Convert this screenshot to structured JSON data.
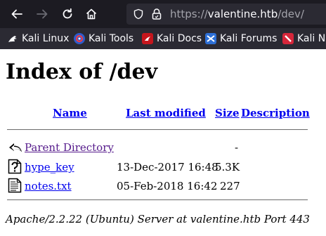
{
  "browser": {
    "url_scheme": "https://",
    "url_host": "valentine.htb",
    "url_path": "/dev/",
    "icons": [
      "back-arrow-icon",
      "forward-arrow-icon",
      "reload-icon",
      "home-icon",
      "shield-icon",
      "lock-icon"
    ],
    "bookmarks": [
      {
        "label": "Kali Linux",
        "icon": "kali-dragon-icon"
      },
      {
        "label": "Kali Tools",
        "icon": "kali-tools-icon"
      },
      {
        "label": "Kali Docs",
        "icon": "kali-docs-icon"
      },
      {
        "label": "Kali Forums",
        "icon": "kali-forums-icon"
      },
      {
        "label": "Kali Ne",
        "icon": "kali-nethunter-icon"
      }
    ]
  },
  "page": {
    "title": "Index of /dev",
    "columns": {
      "name": "Name",
      "last_modified": "Last modified",
      "size": "Size",
      "description": "Description"
    },
    "rows": [
      {
        "icon": "back-folder-icon",
        "name": "Parent Directory",
        "modified": "",
        "size": "-",
        "visited": true
      },
      {
        "icon": "unknown-file-icon",
        "name": "hype_key",
        "modified": "13-Dec-2017 16:48",
        "size": "5.3K",
        "visited": false
      },
      {
        "icon": "text-file-icon",
        "name": "notes.txt",
        "modified": "05-Feb-2018 16:42",
        "size": "227",
        "visited": false
      }
    ],
    "footer": "Apache/2.2.22 (Ubuntu) Server at valentine.htb Port 443"
  },
  "colors": {
    "toolbar_bg": "#1c1b22",
    "bookmarks_bg": "#2b2a33",
    "link": "#0000ee",
    "visited_link": "#551a8b"
  }
}
